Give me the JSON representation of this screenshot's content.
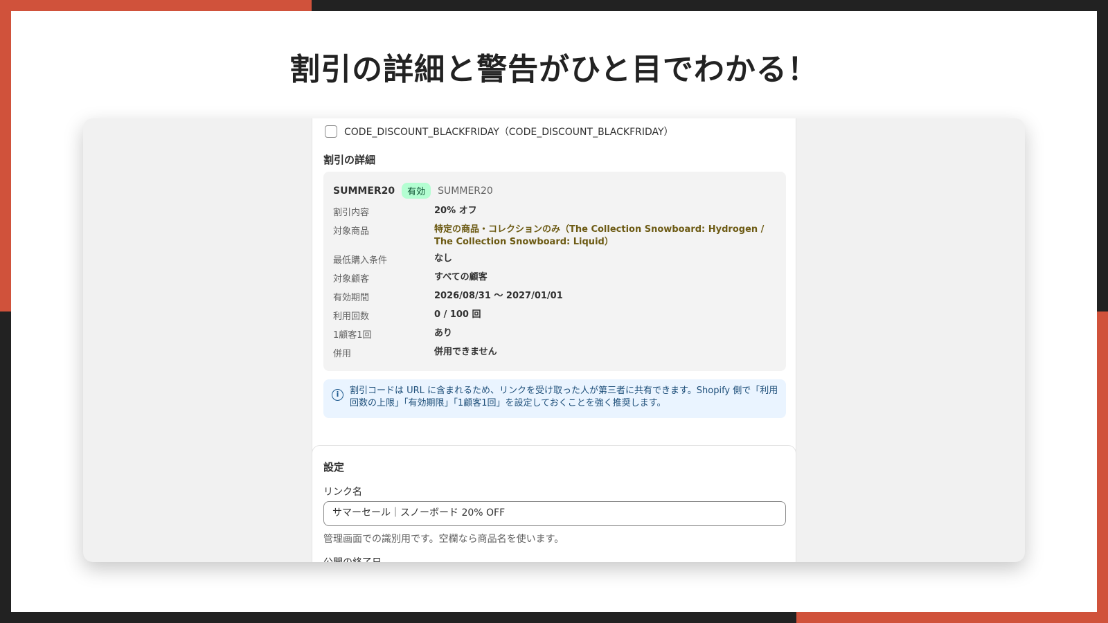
{
  "slide": {
    "headline": "割引の詳細と警告がひと目でわかる！"
  },
  "discount_list": {
    "checkbox_label": "CODE_DISCOUNT_BLACKFRIDAY（CODE_DISCOUNT_BLACKFRIDAY）"
  },
  "details": {
    "section_title": "割引の詳細",
    "code_name": "SUMMER20",
    "status_badge": "有効",
    "code_sub": "SUMMER20",
    "rows": [
      {
        "key": "割引内容",
        "value": "20% オフ"
      },
      {
        "key": "対象商品",
        "value": "特定の商品・コレクションのみ（The Collection Snowboard: Hydrogen / The Collection Snowboard: Liquid）"
      },
      {
        "key": "最低購入条件",
        "value": "なし"
      },
      {
        "key": "対象顧客",
        "value": "すべての顧客"
      },
      {
        "key": "有効期間",
        "value": "2026/08/31 〜 2027/01/01"
      },
      {
        "key": "利用回数",
        "value": "0 / 100 回"
      },
      {
        "key": "1顧客1回",
        "value": "あり"
      },
      {
        "key": "併用",
        "value": "併用できません"
      }
    ]
  },
  "notice": {
    "icon": "info-icon",
    "text": "割引コードは URL に含まれるため、リンクを受け取った人が第三者に共有できます。Shopify 側で「利用回数の上限」「有効期限」「1顧客1回」を設定しておくことを強く推奨します。"
  },
  "settings": {
    "title": "設定",
    "link_name_label": "リンク名",
    "link_name_value": "サマーセール｜スノーボード 20% OFF",
    "link_name_help": "管理画面での識別用です。空欄なら商品名を使います。",
    "next_label": "公開の終了日"
  },
  "colors": {
    "accent_red": "#d0523b",
    "dark": "#222222",
    "badge_bg": "#b4fed2",
    "notice_bg": "#eaf4ff"
  }
}
